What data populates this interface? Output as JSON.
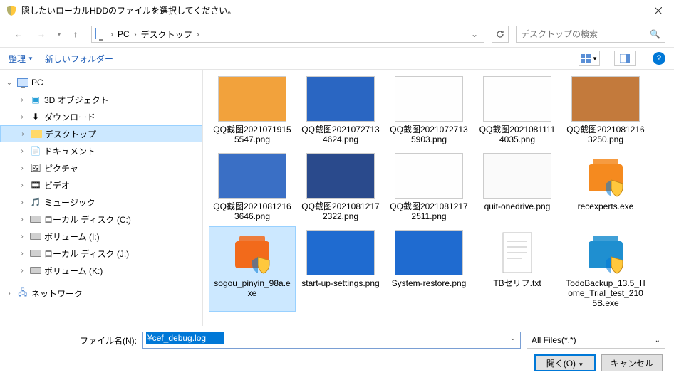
{
  "window": {
    "title": "隠したいローカルHDDのファイルを選択してください。"
  },
  "breadcrumb": {
    "pc": "PC",
    "desktop": "デスクトップ"
  },
  "search": {
    "placeholder": "デスクトップの検索"
  },
  "toolbar": {
    "organize": "整理",
    "newfolder": "新しいフォルダー"
  },
  "tree": {
    "pc": "PC",
    "items": [
      "3D オブジェクト",
      "ダウンロード",
      "デスクトップ",
      "ドキュメント",
      "ピクチャ",
      "ビデオ",
      "ミュージック",
      "ローカル ディスク (C:)",
      "ボリューム (I:)",
      "ローカル ディスク (J:)",
      "ボリューム (K:)"
    ],
    "network": "ネットワーク"
  },
  "files": [
    {
      "name": "QQ截图20210719155547.png",
      "type": "img",
      "tint": "#f2a23c"
    },
    {
      "name": "QQ截图20210727134624.png",
      "type": "img",
      "tint": "#2a66c2"
    },
    {
      "name": "QQ截图20210727135903.png",
      "type": "img",
      "tint": "#fefefe"
    },
    {
      "name": "QQ截图20210811114035.png",
      "type": "img",
      "tint": "#fefefe"
    },
    {
      "name": "QQ截图20210812163250.png",
      "type": "img",
      "tint": "#c37a3c"
    },
    {
      "name": "QQ截图20210812163646.png",
      "type": "img",
      "tint": "#3a6fc5"
    },
    {
      "name": "QQ截图20210812172322.png",
      "type": "img",
      "tint": "#2a4a8c"
    },
    {
      "name": "QQ截图20210812172511.png",
      "type": "img",
      "tint": "#fefefe"
    },
    {
      "name": "quit-onedrive.png",
      "type": "img",
      "tint": "#fafafa"
    },
    {
      "name": "recexperts.exe",
      "type": "exe",
      "color": "#f58a1f",
      "badge": "EaseUS"
    },
    {
      "name": "sogou_pinyin_98a.exe",
      "type": "exe",
      "color": "#f26a1b",
      "selected": true
    },
    {
      "name": "start-up-settings.png",
      "type": "img",
      "tint": "#1f6bd0"
    },
    {
      "name": "System-restore.png",
      "type": "img",
      "tint": "#1f6bd0"
    },
    {
      "name": "TBセリフ.txt",
      "type": "txt"
    },
    {
      "name": "TodoBackup_13.5_Home_Trial_test_2105B.exe",
      "type": "exe",
      "color": "#1f8fd0"
    }
  ],
  "footer": {
    "filename_label": "ファイル名(N):",
    "filename_value": "¥cef_debug.log",
    "filter": "All Files(*.*)",
    "open": "開く(O)",
    "cancel": "キャンセル"
  }
}
